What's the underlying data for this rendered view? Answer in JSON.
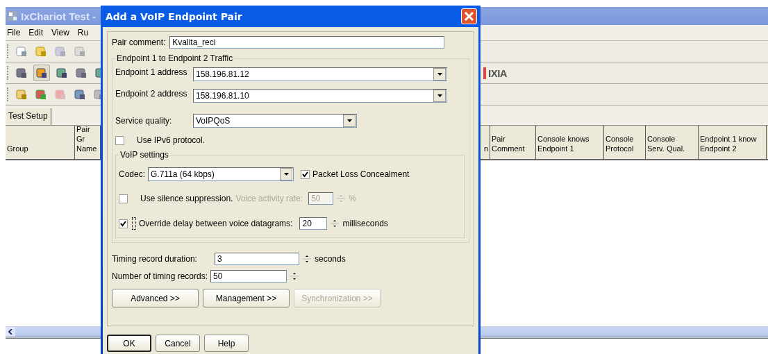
{
  "app": {
    "title": "IxChariot Test -",
    "menu": [
      "File",
      "Edit",
      "View",
      "Ru"
    ],
    "logo": "IXIA",
    "tabs": [
      {
        "label": "Test Setup",
        "selected": true
      }
    ],
    "table": {
      "columns_left": [
        "Group",
        "Pair Gr\nName"
      ],
      "columns_right": [
        "n",
        "Pair\nComment",
        "Console knows\nEndpoint 1",
        "Console\nProtocol",
        "Console\nServ. Qual.",
        "Endpoint 1 know\nEndpoint 2"
      ]
    }
  },
  "dialog": {
    "title": "Add a VoIP Endpoint Pair",
    "pair_comment": {
      "label": "Pair comment:",
      "value": "Kvalita_reci"
    },
    "traffic": {
      "title": "Endpoint 1 to Endpoint 2 Traffic",
      "endpoint1": {
        "label": "Endpoint 1 address",
        "value": "158.196.81.12"
      },
      "endpoint2": {
        "label": "Endpoint 2 address",
        "value": "158.196.81.10"
      },
      "service_quality": {
        "label": "Service quality:",
        "value": "VoIPQoS"
      },
      "ipv6": {
        "label": "Use IPv6 protocol.",
        "checked": false
      },
      "voip": {
        "title": "VoIP settings",
        "codec": {
          "label": "Codec:",
          "value": "G.711a (64 kbps)"
        },
        "plc": {
          "label": "Packet Loss Concealment",
          "checked": true
        },
        "silence": {
          "label": "Use silence suppression.",
          "checked": false
        },
        "voice_activity": {
          "label": "Voice activity rate:",
          "value": "50",
          "unit": "%",
          "disabled": true
        },
        "override": {
          "label": "Override delay between voice datagrams:",
          "checked": true,
          "focused": true,
          "value": "20",
          "unit": "milliseconds"
        }
      }
    },
    "timing_duration": {
      "label": "Timing record duration:",
      "value": "3",
      "unit": "seconds"
    },
    "timing_records": {
      "label": "Number of timing records:",
      "value": "50"
    },
    "buttons": [
      {
        "label": "Advanced >>",
        "disabled": false
      },
      {
        "label": "Management >>",
        "disabled": false
      },
      {
        "label": "Synchronization >>",
        "disabled": true
      }
    ],
    "footer_buttons": [
      {
        "label": "OK",
        "default": true
      },
      {
        "label": "Cancel",
        "default": false
      },
      {
        "label": "Help",
        "default": false
      }
    ]
  }
}
